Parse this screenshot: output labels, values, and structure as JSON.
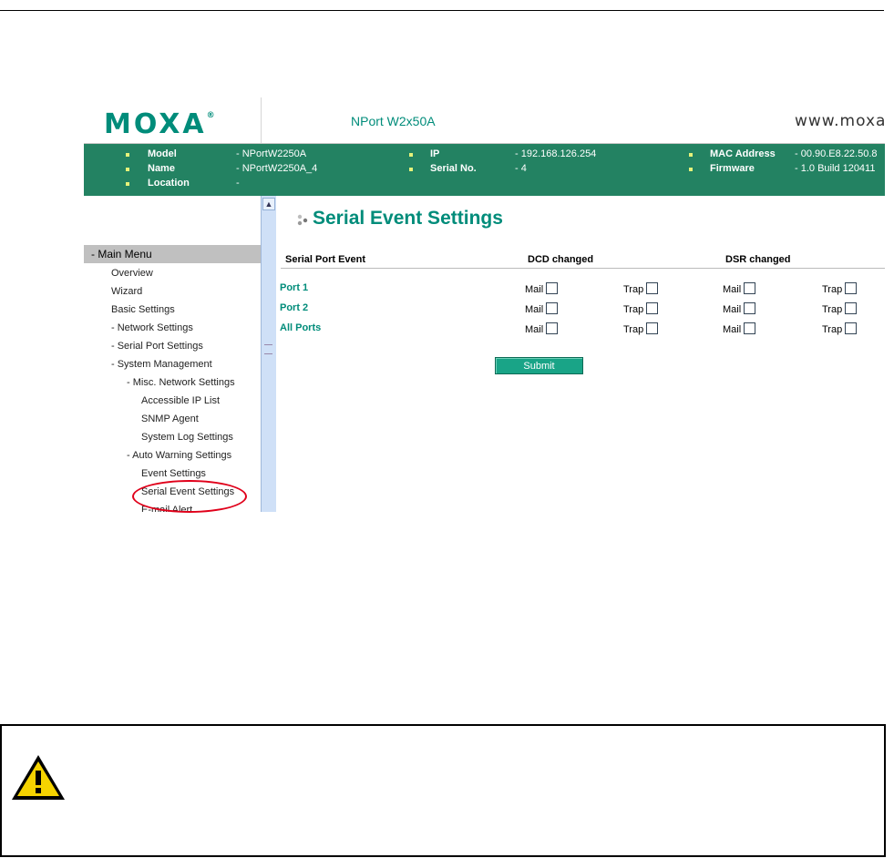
{
  "header": {
    "logo": "MOXA",
    "logo_mark": "®",
    "product": "NPort W2x50A",
    "website": "www.moxa"
  },
  "info_bar": {
    "col1": [
      {
        "label": "Model",
        "value": "- NPortW2250A"
      },
      {
        "label": "Name",
        "value": "- NPortW2250A_4"
      },
      {
        "label": "Location",
        "value": "-"
      }
    ],
    "col2": [
      {
        "label": "IP",
        "value": "- 192.168.126.254"
      },
      {
        "label": "Serial No.",
        "value": "- 4"
      }
    ],
    "col3": [
      {
        "label": "MAC Address",
        "value": "- 00.90.E8.22.50.8"
      },
      {
        "label": "Firmware",
        "value": "- 1.0 Build 120411"
      }
    ]
  },
  "sidebar": {
    "heading": "- Main Menu",
    "items": [
      "Overview",
      "Wizard",
      "Basic Settings",
      "- Network Settings",
      "- Serial Port Settings",
      "- System Management",
      "- Misc. Network Settings",
      "Accessible IP List",
      "SNMP Agent",
      "System Log Settings",
      "- Auto Warning Settings",
      "Event Settings",
      "Serial Event Settings",
      "E-mail Alert"
    ]
  },
  "main": {
    "title": "Serial Event Settings",
    "columns": [
      "Serial Port Event",
      "DCD changed",
      "DSR changed"
    ],
    "rows": [
      "Port 1",
      "Port 2",
      "All Ports"
    ],
    "mail_label": "Mail",
    "trap_label": "Trap",
    "submit_label": "Submit"
  },
  "colors": {
    "brand": "#008c7a",
    "info_bar": "#238262",
    "highlight": "#e0001a"
  }
}
